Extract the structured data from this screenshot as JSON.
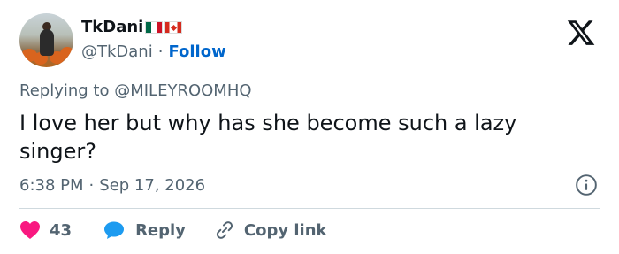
{
  "author": {
    "display_name": "TkDani",
    "flags": [
      "mexico-flag",
      "canada-flag"
    ],
    "handle": "@TkDani",
    "separator": "·",
    "follow_label": "Follow"
  },
  "reply": {
    "prefix": "Replying to",
    "mention": "@MILEYROOMHQ"
  },
  "tweet": {
    "text": "I love her but why has she become such a lazy singer?"
  },
  "meta": {
    "time": "6:38 PM",
    "separator": "·",
    "date": "Sep 17, 2026"
  },
  "actions": {
    "like_count": "43",
    "reply_label": "Reply",
    "copy_label": "Copy link"
  },
  "colors": {
    "like": "#f91880",
    "reply": "#1d9bf0",
    "link": "#0066cc",
    "muted": "#536471",
    "text": "#0f1419"
  },
  "icons": [
    "x-logo-icon",
    "info-icon",
    "heart-icon",
    "speech-bubble-icon",
    "link-icon"
  ]
}
